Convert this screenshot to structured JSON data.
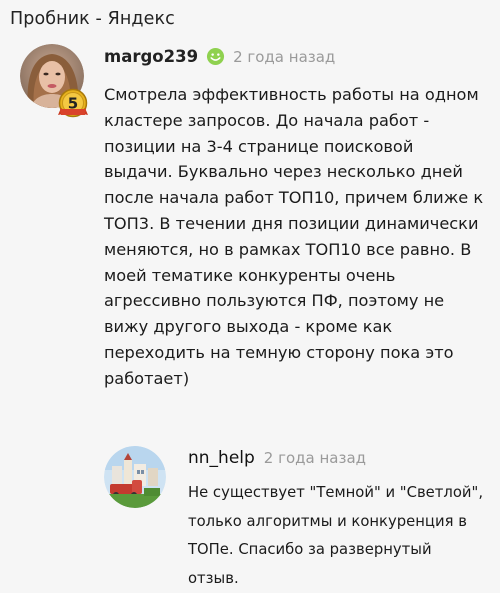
{
  "page": {
    "title": "Пробник - Яндекс"
  },
  "comments": [
    {
      "author": "margo239",
      "date": "2 года назад",
      "level_badge": "5",
      "online": true,
      "text_lines": [
        "Смотрела эффективность работы на одном",
        "кластере запросов. До начала работ -",
        "позиции на 3-4 странице поисковой",
        "выдачи. Буквально через несколько дней",
        "после начала работ ТОП10, причем ближе к",
        "ТОП3. В течении дня позиции динамически",
        "меняются, но в рамках ТОП10 все равно.  В",
        "моей тематике конкуренты очень",
        "агрессивно пользуются ПФ, поэтому не",
        "вижу другого выхода - кроме как",
        "переходить на темную сторону пока это",
        "работает)"
      ]
    },
    {
      "author": "nn_help",
      "date": "2 года назад",
      "text_lines": [
        "Не существует \"Темной\" и \"Светлой\",",
        "только алгоритмы и конкуренция в",
        "ТОПе. Спасибо за развернутый",
        "отзыв."
      ]
    }
  ],
  "colors": {
    "background": "#f6f6f6",
    "date_gray": "#9a9a9a",
    "online_green": "#8fd14f",
    "badge_gold": "#e7b21d"
  },
  "icons": {
    "online": "smiley-online-icon",
    "badge": "level-badge-icon"
  }
}
